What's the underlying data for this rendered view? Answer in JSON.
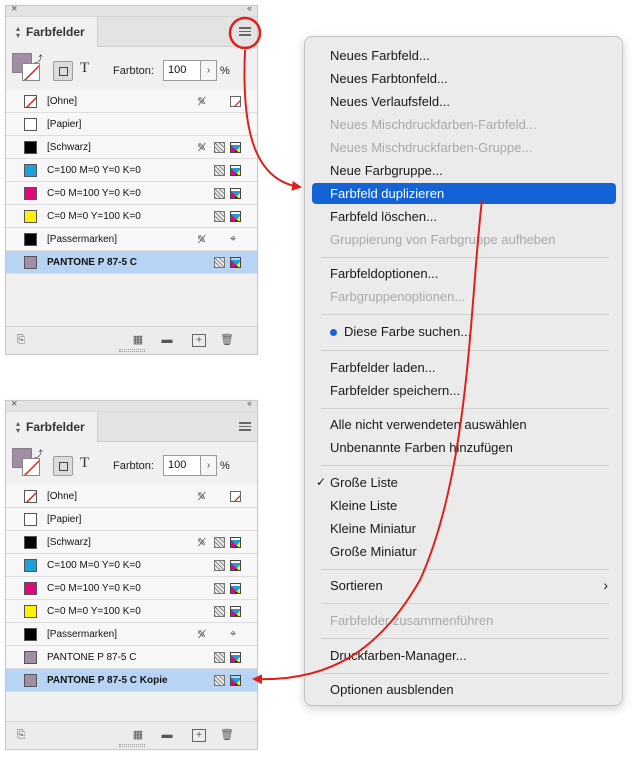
{
  "colors": {
    "accent": "#1463d6",
    "arrow": "#e0201a",
    "pantone": "#a18ea4",
    "cyan": "#1ba0d8",
    "magenta": "#e0087c",
    "yellow": "#fff200",
    "black": "#000000"
  },
  "panel_top": {
    "title": "Farbfelder",
    "tint_label": "Farbton:",
    "tint_value": "100",
    "tint_unit": "%",
    "swatches": [
      {
        "name": "[Ohne]",
        "icons": [
          "no-edit-icon",
          "none-icon"
        ]
      },
      {
        "name": "[Papier]",
        "icons": []
      },
      {
        "name": "[Schwarz]",
        "icons": [
          "no-edit-icon",
          "process-icon",
          "cmyk-icon"
        ]
      },
      {
        "name": "C=100 M=0 Y=0 K=0",
        "icons": [
          "process-icon",
          "cmyk-icon"
        ]
      },
      {
        "name": "C=0 M=100 Y=0 K=0",
        "icons": [
          "process-icon",
          "cmyk-icon"
        ]
      },
      {
        "name": "C=0 M=0 Y=100 K=0",
        "icons": [
          "process-icon",
          "cmyk-icon"
        ]
      },
      {
        "name": "[Passermarken]",
        "icons": [
          "no-edit-icon",
          "registration-icon"
        ]
      },
      {
        "name": "PANTONE P 87-5 C",
        "icons": [
          "process-icon",
          "cmyk-icon"
        ],
        "selected": true
      }
    ]
  },
  "panel_bottom": {
    "title": "Farbfelder",
    "tint_label": "Farbton:",
    "tint_value": "100",
    "tint_unit": "%",
    "swatches": [
      {
        "name": "[Ohne]"
      },
      {
        "name": "[Papier]"
      },
      {
        "name": "[Schwarz]"
      },
      {
        "name": "C=100 M=0 Y=0 K=0"
      },
      {
        "name": "C=0 M=100 Y=0 K=0"
      },
      {
        "name": "C=0 M=0 Y=100 K=0"
      },
      {
        "name": "[Passermarken]"
      },
      {
        "name": "PANTONE P 87-5 C"
      },
      {
        "name": "PANTONE P 87-5 C Kopie",
        "selected": true
      }
    ]
  },
  "menu": {
    "items": [
      {
        "label": "Neues Farbfeld..."
      },
      {
        "label": "Neues Farbtonfeld..."
      },
      {
        "label": "Neues Verlaufsfeld..."
      },
      {
        "label": "Neues Mischdruckfarben-Farbfeld...",
        "disabled": true
      },
      {
        "label": "Neues Mischdruckfarben-Gruppe...",
        "disabled": true
      },
      {
        "label": "Neue Farbgruppe..."
      },
      {
        "label": "Farbfeld duplizieren",
        "highlighted": true
      },
      {
        "label": "Farbfeld löschen..."
      },
      {
        "label": "Gruppierung von Farbgruppe aufheben",
        "disabled": true
      },
      {
        "label": "Farbfeldoptionen..."
      },
      {
        "label": "Farbgruppenoptionen...",
        "disabled": true
      },
      {
        "label": "Diese Farbe suchen..."
      },
      {
        "label": "Farbfelder laden..."
      },
      {
        "label": "Farbfelder speichern..."
      },
      {
        "label": "Alle nicht verwendeten auswählen"
      },
      {
        "label": "Unbenannte Farben hinzufügen"
      },
      {
        "label": "Große Liste",
        "checked": true
      },
      {
        "label": "Kleine Liste"
      },
      {
        "label": "Kleine Miniatur"
      },
      {
        "label": "Große Miniatur"
      },
      {
        "label": "Sortieren",
        "submenu": true
      },
      {
        "label": "Farbfelder zusammenführen",
        "disabled": true
      },
      {
        "label": "Druckfarben-Manager..."
      },
      {
        "label": "Optionen ausblenden"
      }
    ],
    "check_glyph": "✓",
    "submenu_glyph": "›"
  }
}
